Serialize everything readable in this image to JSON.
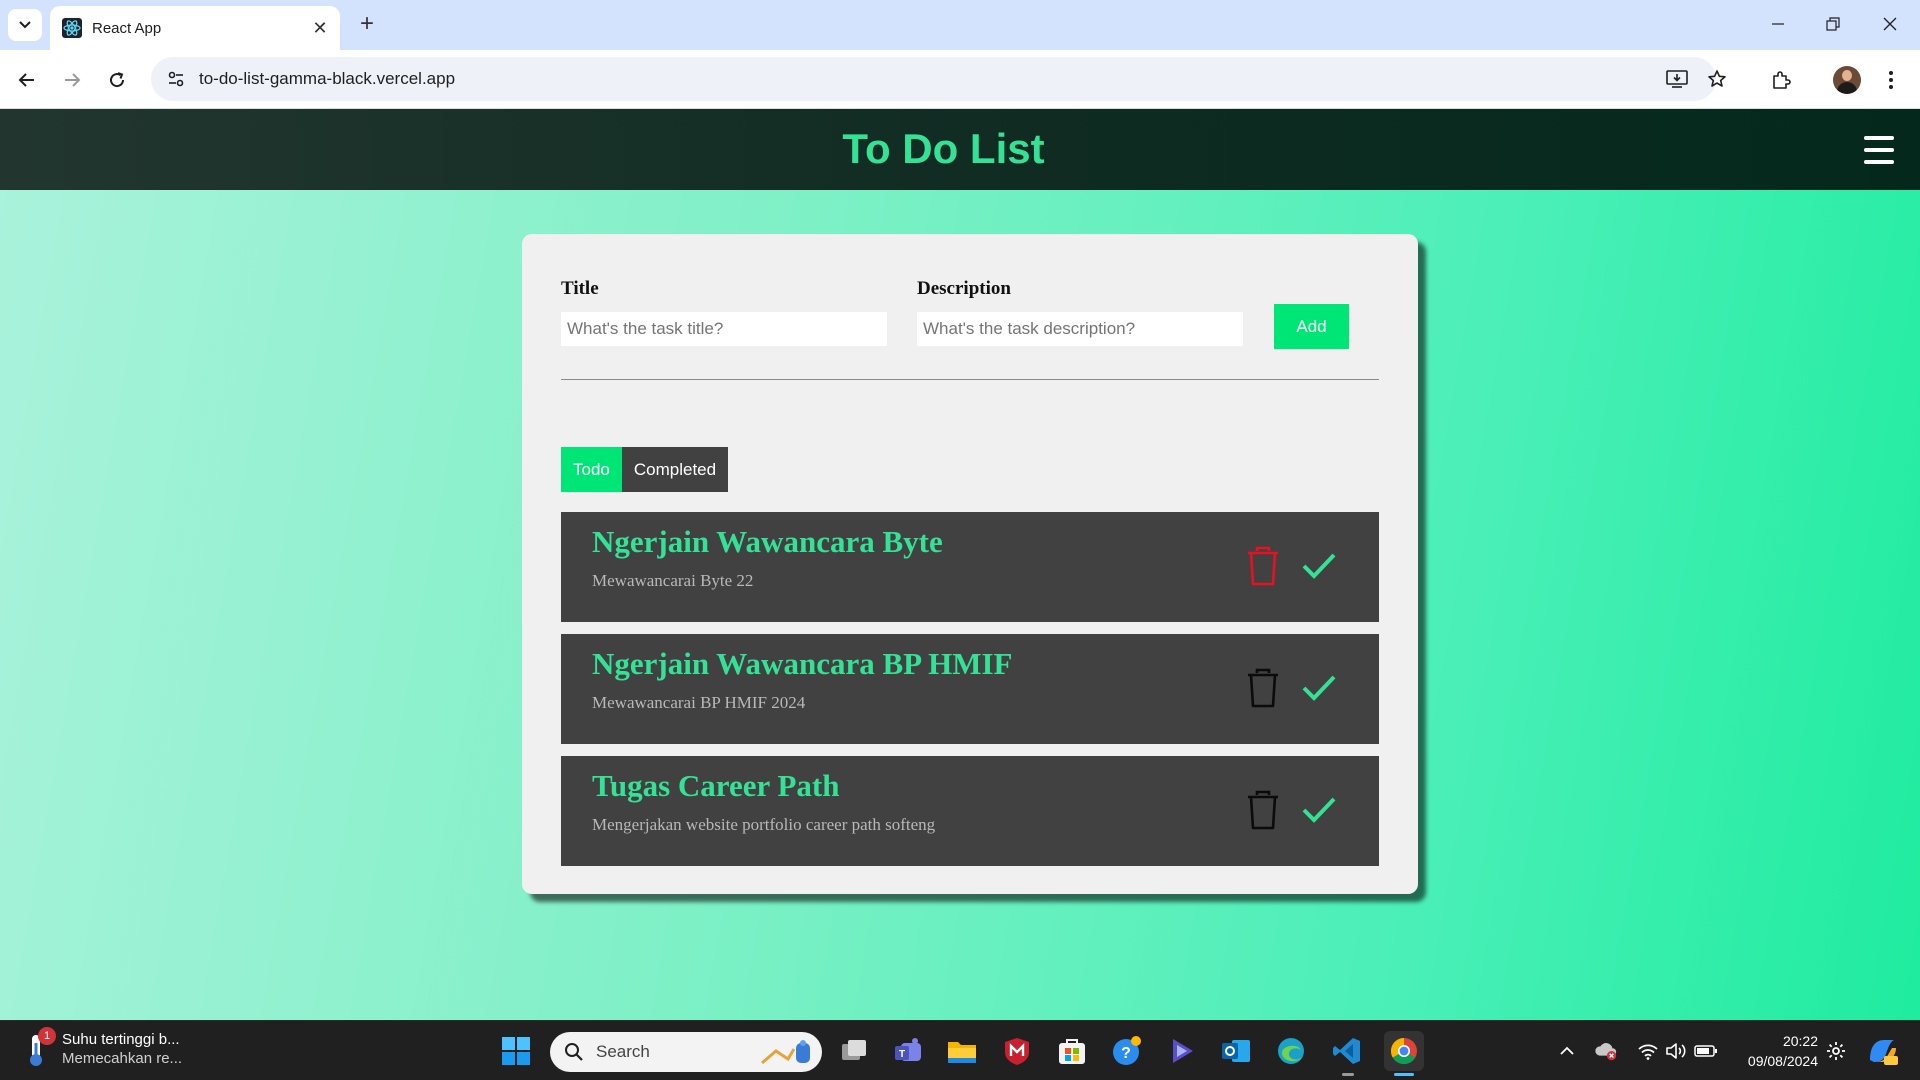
{
  "browser": {
    "tab_title": "React App",
    "url": "to-do-list-gamma-black.vercel.app"
  },
  "app": {
    "title": "To Do List",
    "form": {
      "title_label": "Title",
      "title_placeholder": "What's the task title?",
      "description_label": "Description",
      "description_placeholder": "What's the task description?",
      "add_label": "Add"
    },
    "tabs": [
      {
        "label": "Todo",
        "active": true
      },
      {
        "label": "Completed",
        "active": false
      }
    ],
    "todos": [
      {
        "title": "Ngerjain Wawancara Byte",
        "description": "Mewawancarai Byte 22"
      },
      {
        "title": "Ngerjain Wawancara BP HMIF",
        "description": "Mewawancarai BP HMIF 2024"
      },
      {
        "title": "Tugas Career Path",
        "description": "Mengerjakan website portfolio career path softeng"
      }
    ],
    "colors": {
      "accent": "#00e676",
      "title_green": "#34e296",
      "item_bg": "#414141",
      "delete_hover": "#e81123"
    }
  },
  "taskbar": {
    "weather_line1": "Suhu tertinggi b...",
    "weather_line2": "Memecahkan re...",
    "weather_badge": "1",
    "search_label": "Search",
    "time": "20:22",
    "date": "09/08/2024"
  }
}
